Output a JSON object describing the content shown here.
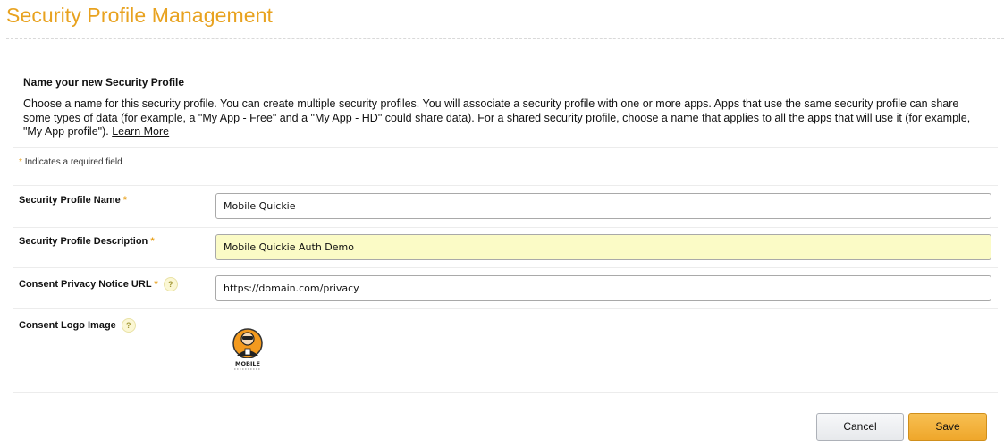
{
  "page": {
    "title": "Security Profile Management"
  },
  "intro": {
    "heading": "Name your new Security Profile",
    "description": "Choose a name for this security profile. You can create multiple security profiles. You will associate a security profile with one or more apps. Apps that use the same security profile can share some types of data (for example, a \"My App - Free\" and a \"My App - HD\" could share data). For a shared security profile, choose a name that applies to all the apps that will use it (for example, \"My App profile\").",
    "learn_more_link": "Learn More"
  },
  "form": {
    "required_marker": "*",
    "required_note": "Indicates a required field",
    "fields": {
      "name": {
        "label": "Security Profile Name",
        "value": "Mobile Quickie"
      },
      "description": {
        "label": "Security Profile Description",
        "value": "Mobile Quickie Auth Demo"
      },
      "privacy_url": {
        "label": "Consent Privacy Notice URL",
        "value": "https://domain.com/privacy",
        "help_icon": "help-question-icon"
      },
      "logo": {
        "label": "Consent Logo Image",
        "help_icon": "help-question-icon",
        "image_text": "MOBILE"
      }
    },
    "help_glyph": "?"
  },
  "actions": {
    "cancel_label": "Cancel",
    "save_label": "Save"
  },
  "colors": {
    "accent": "#e8a21f",
    "highlight_field": "#fbfbc6",
    "save_button": "#f0a830"
  }
}
